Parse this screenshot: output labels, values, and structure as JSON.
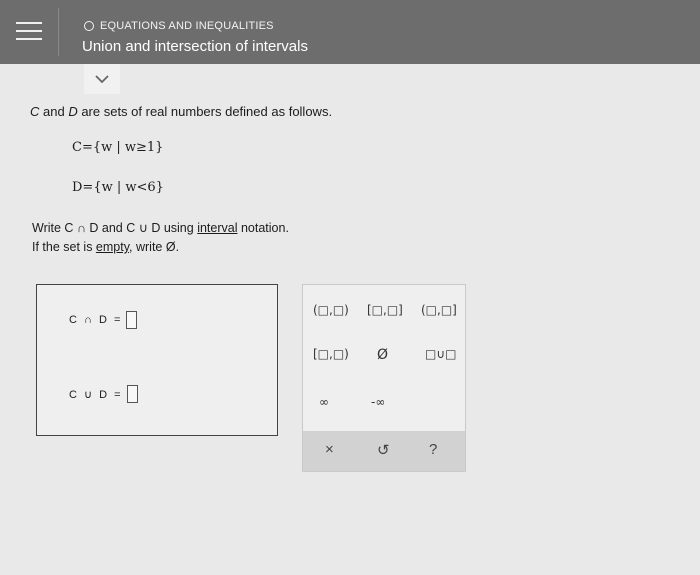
{
  "header": {
    "topic": "EQUATIONS AND INEQUALITIES",
    "title": "Union and intersection of intervals"
  },
  "problem": {
    "intro_prefix": "C",
    "intro_mid": " and ",
    "intro_d": "D",
    "intro_suffix": " are sets of real numbers defined as follows.",
    "set_c": "C={w | w≥1}",
    "set_d": "D={w | w<6}",
    "instruction_prefix": "Write C ∩ D and C ∪ D using ",
    "instruction_link": "interval",
    "instruction_suffix": " notation.",
    "empty_prefix": "If the set is ",
    "empty_link": "empty",
    "empty_suffix": ", write Ø."
  },
  "answers": {
    "intersection_label": "C ∩ D =",
    "union_label": "C ∪ D ="
  },
  "keypad": {
    "keys": [
      "(□,□)",
      "[□,□]",
      "(□,□]",
      "[□,□)",
      "Ø",
      "□∪□",
      "∞",
      "-∞"
    ],
    "actions": [
      "×",
      "↺",
      "?"
    ]
  },
  "colors": {
    "header_bg": "#6d6d6d",
    "page_bg": "#e9e9e9"
  }
}
